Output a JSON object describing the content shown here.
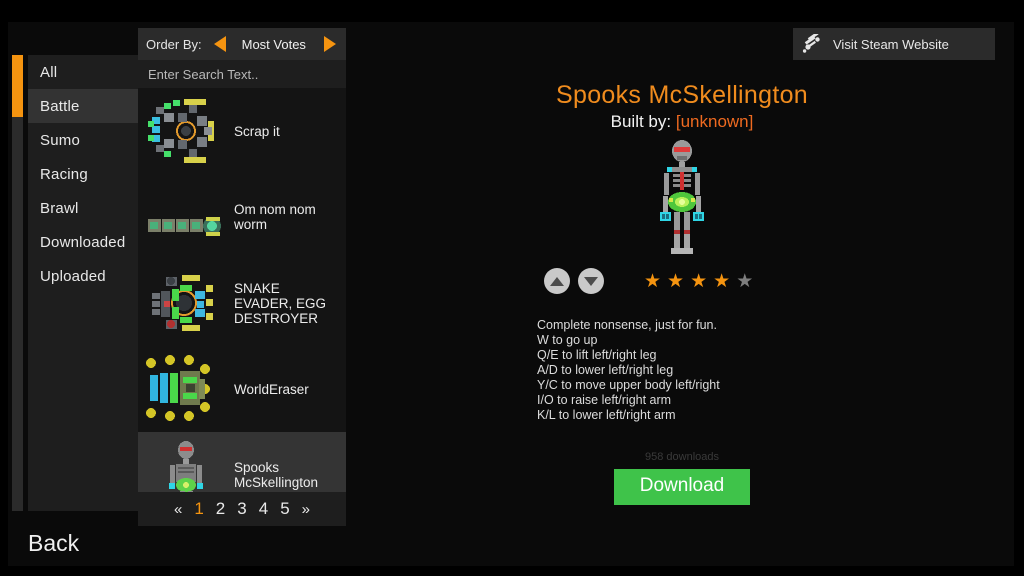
{
  "window": {
    "background": "#0a0a0a",
    "accent": "#f59410"
  },
  "sidebar": {
    "items": [
      {
        "label": "All",
        "active": false
      },
      {
        "label": "Battle",
        "active": true
      },
      {
        "label": "Sumo",
        "active": false
      },
      {
        "label": "Racing",
        "active": false
      },
      {
        "label": "Brawl",
        "active": false
      },
      {
        "label": "Downloaded",
        "active": false
      },
      {
        "label": "Uploaded",
        "active": false
      }
    ]
  },
  "order_bar": {
    "label": "Order By:",
    "value": "Most Votes",
    "prev_icon": "triangle-left-icon",
    "next_icon": "triangle-right-icon"
  },
  "search": {
    "placeholder": "Enter Search Text..",
    "value": ""
  },
  "list": {
    "items": [
      {
        "name": "Scrap it",
        "selected": false
      },
      {
        "name": "Om nom nom worm",
        "selected": false
      },
      {
        "name": "SNAKE EVADER, EGG DESTROYER",
        "selected": false
      },
      {
        "name": "WorldEraser",
        "selected": false
      },
      {
        "name": "Spooks McSkellington",
        "selected": true
      }
    ]
  },
  "pagination": {
    "first": "«",
    "last": "»",
    "pages": [
      "1",
      "2",
      "3",
      "4",
      "5"
    ],
    "current": "1"
  },
  "steam_button": {
    "label": "Visit Steam Website",
    "icon": "steam-icon"
  },
  "detail": {
    "title": "Spooks McSkellington",
    "built_by_label": "Built by:",
    "author": "[unknown]",
    "rating": {
      "filled": 4,
      "total": 5,
      "upvote_icon": "chevron-up-icon",
      "downvote_icon": "chevron-down-icon"
    },
    "description_lines": [
      "Complete nonsense, just for fun.",
      "W to go up",
      "Q/E to lift left/right leg",
      "A/D to lower left/right leg",
      "Y/C to move upper body left/right",
      "I/O to raise left/right arm",
      "K/L to lower left/right arm"
    ],
    "downloads": "958 downloads",
    "download_button": "Download",
    "download_button_color": "#3fc34a"
  },
  "back_button": {
    "label": "Back"
  }
}
